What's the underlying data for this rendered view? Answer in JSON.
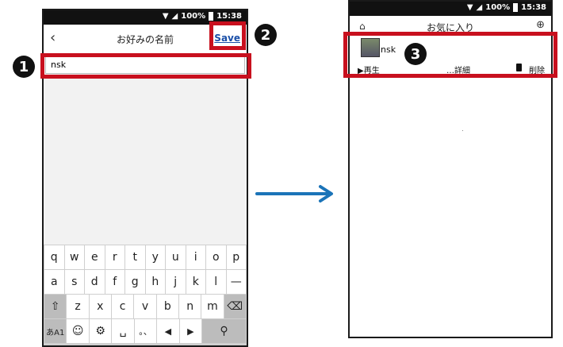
{
  "status": {
    "battery": "100%",
    "time": "15:38"
  },
  "left_screen": {
    "title": "お好みの名前",
    "save_label": "Save",
    "name_value": "nsk",
    "keyboard": {
      "row1": [
        "q",
        "w",
        "e",
        "r",
        "t",
        "y",
        "u",
        "i",
        "o",
        "p"
      ],
      "row2": [
        "a",
        "s",
        "d",
        "f",
        "g",
        "h",
        "j",
        "k",
        "l",
        "—"
      ],
      "row3_letters": [
        "z",
        "x",
        "c",
        "v",
        "b",
        "n",
        "m"
      ],
      "lang_label": "あA1"
    }
  },
  "right_screen": {
    "title": "お気に入り",
    "item_name": "nsk",
    "play_label": "▶再生",
    "details_label": "…詳細",
    "delete_label": "削除"
  },
  "badges": [
    "1",
    "2",
    "3"
  ],
  "colors": {
    "highlight": "#c8101e",
    "arrow": "#1b74b8",
    "link": "#1a4fa8"
  }
}
